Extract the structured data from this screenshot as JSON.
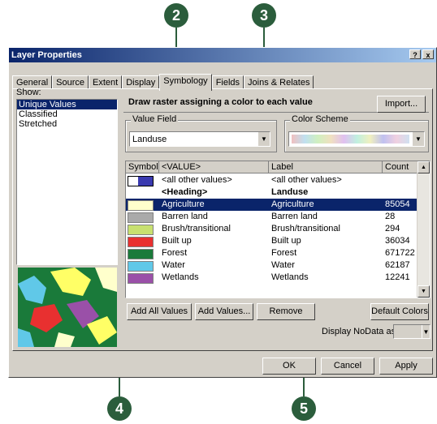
{
  "callouts": [
    "2",
    "3",
    "4",
    "5"
  ],
  "window": {
    "title": "Layer Properties",
    "help": "?",
    "close": "x"
  },
  "tabs": [
    "General",
    "Source",
    "Extent",
    "Display",
    "Symbology",
    "Fields",
    "Joins & Relates"
  ],
  "show": {
    "label": "Show:",
    "items": [
      "Unique Values",
      "Classified",
      "Stretched"
    ]
  },
  "header": {
    "text": "Draw raster assigning a color to each value",
    "import": "Import..."
  },
  "value_field": {
    "label": "Value Field",
    "value": "Landuse"
  },
  "color_scheme": {
    "label": "Color Scheme"
  },
  "table": {
    "headers": [
      "Symbol",
      "<VALUE>",
      "Label",
      "Count"
    ],
    "rows": [
      {
        "value": "<all other values>",
        "label": "<all other values>",
        "count": "",
        "color": "#3a3ab0"
      },
      {
        "value": "<Heading>",
        "label": "Landuse",
        "count": "",
        "color": ""
      },
      {
        "value": "Agriculture",
        "label": "Agriculture",
        "count": "85054",
        "color": "#ffffcc"
      },
      {
        "value": "Barren land",
        "label": "Barren land",
        "count": "28",
        "color": "#aaaaaa"
      },
      {
        "value": "Brush/transitional",
        "label": "Brush/transitional",
        "count": "294",
        "color": "#c8e070"
      },
      {
        "value": "Built up",
        "label": "Built up",
        "count": "36034",
        "color": "#e83030"
      },
      {
        "value": "Forest",
        "label": "Forest",
        "count": "671722",
        "color": "#1a7a3a"
      },
      {
        "value": "Water",
        "label": "Water",
        "count": "62187",
        "color": "#60c8e8"
      },
      {
        "value": "Wetlands",
        "label": "Wetlands",
        "count": "12241",
        "color": "#9a50a8"
      }
    ]
  },
  "buttons": {
    "add_all": "Add All Values",
    "add_values": "Add Values...",
    "remove": "Remove",
    "default_colors": "Default Colors",
    "nodata_label": "Display NoData as",
    "ok": "OK",
    "cancel": "Cancel",
    "apply": "Apply"
  }
}
